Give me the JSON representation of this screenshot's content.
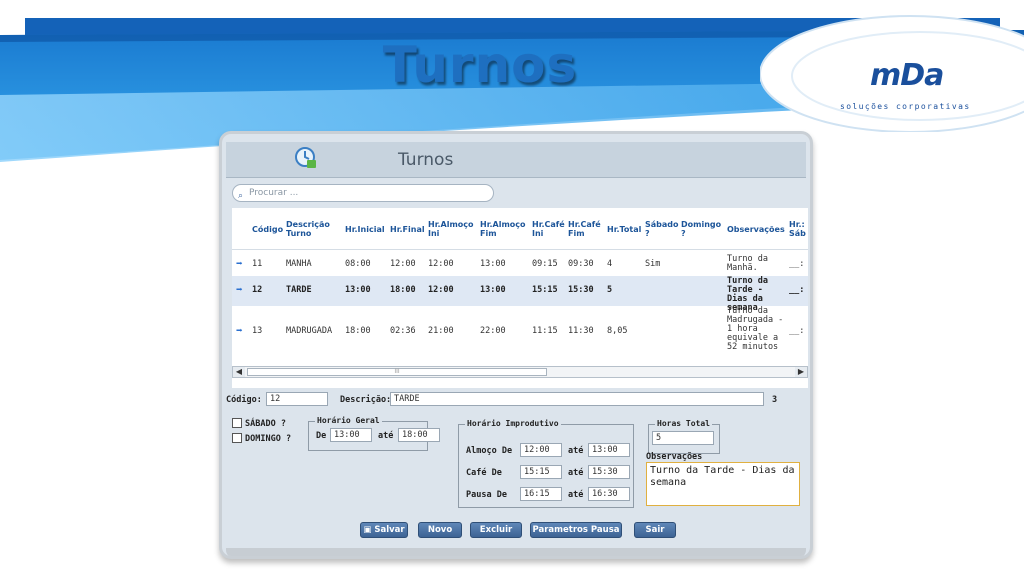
{
  "slide": {
    "title": "Turnos",
    "logo_text": "mDa",
    "logo_sub": "soluções corporativas"
  },
  "app": {
    "title": "Turnos",
    "search_placeholder": "Procurar ...",
    "columns": [
      "Código",
      "Descrição Turno",
      "Hr.Inicial",
      "Hr.Final",
      "Hr.Almoço Ini",
      "Hr.Almoço Fim",
      "Hr.Café Ini",
      "Hr.Café Fim",
      "Hr.Total",
      "Sábado ?",
      "Domingo ?",
      "Observações",
      "Hr.: Sáb"
    ],
    "rows": [
      {
        "codigo": "11",
        "descricao": "MANHA",
        "hr_inicial": "08:00",
        "hr_final": "12:00",
        "alm_ini": "12:00",
        "alm_fim": "13:00",
        "cafe_ini": "09:15",
        "cafe_fim": "09:30",
        "total": "4",
        "sabado": "Sim",
        "domingo": "",
        "obs": "Turno da Manhã.",
        "extra": "__:"
      },
      {
        "codigo": "12",
        "descricao": "TARDE",
        "hr_inicial": "13:00",
        "hr_final": "18:00",
        "alm_ini": "12:00",
        "alm_fim": "13:00",
        "cafe_ini": "15:15",
        "cafe_fim": "15:30",
        "total": "5",
        "sabado": "",
        "domingo": "",
        "obs": "Turno da Tarde - Dias da semana",
        "extra": "__:"
      },
      {
        "codigo": "13",
        "descricao": "MADRUGADA",
        "hr_inicial": "18:00",
        "hr_final": "02:36",
        "alm_ini": "21:00",
        "alm_fim": "22:00",
        "cafe_ini": "11:15",
        "cafe_fim": "11:30",
        "total": "8,05",
        "sabado": "",
        "domingo": "",
        "obs": "Turno da Madrugada - 1 hora equivale a 52 minutos",
        "extra": "__:"
      }
    ],
    "scroll_thumb": "III",
    "form": {
      "codigo_label": "Código:",
      "codigo_value": "12",
      "descricao_label": "Descrição:",
      "descricao_value": "TARDE",
      "count": "3",
      "sabado_label": "SÁBADO ?",
      "domingo_label": "DOMINGO ?",
      "horario_geral_legend": "Horário Geral",
      "de_label": "De",
      "de_value": "13:00",
      "ate_label": "até",
      "ate_value": "18:00",
      "horario_improdutivo_legend": "Horário Improdutivo",
      "almoco_label": "Almoço De",
      "almoco_de": "12:00",
      "almoco_ate": "13:00",
      "cafe_label": "Café De",
      "cafe_de": "15:15",
      "cafe_ate": "15:30",
      "pausa_label": "Pausa De",
      "pausa_de": "16:15",
      "pausa_ate": "16:30",
      "horas_total_legend": "Horas Total",
      "horas_total_value": "5",
      "observacoes_label": "Observações",
      "observacoes_value": "Turno da Tarde - Dias da semana"
    },
    "buttons": {
      "salvar": "Salvar",
      "novo": "Novo",
      "excluir": "Excluir",
      "parametros": "Parametros Pausa",
      "sair": "Sair"
    }
  },
  "colors": {
    "title_blue": "#1e6fc0",
    "band_blue": "#1f86d9",
    "header_text": "#1d5599",
    "button_blue": "#3d6394"
  }
}
